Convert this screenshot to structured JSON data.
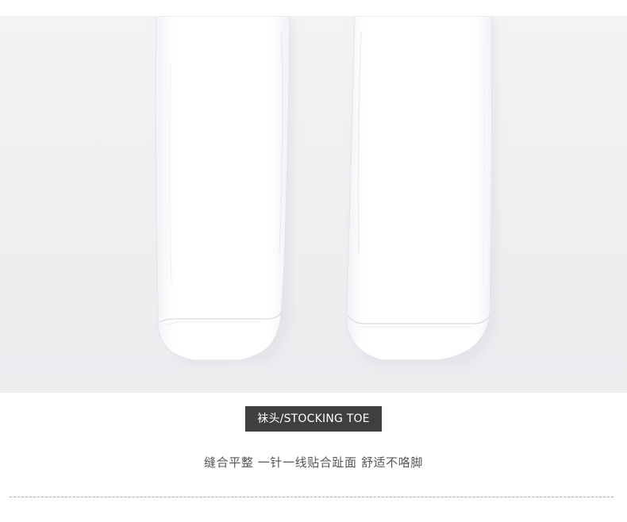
{
  "photo": {
    "subject_icon": "white-stocking-toes-photo",
    "background_color": "#f1f1f3",
    "sock_color": "#ffffff"
  },
  "badge": {
    "label": "袜头/STOCKING TOE",
    "background_color": "#3f3f3f",
    "text_color": "#ffffff"
  },
  "caption": {
    "text": "缝合平整 一针一线贴合趾面 舒适不咯脚",
    "color": "#555555"
  },
  "divider": {
    "style": "dashed",
    "color": "#a9a9a9"
  }
}
